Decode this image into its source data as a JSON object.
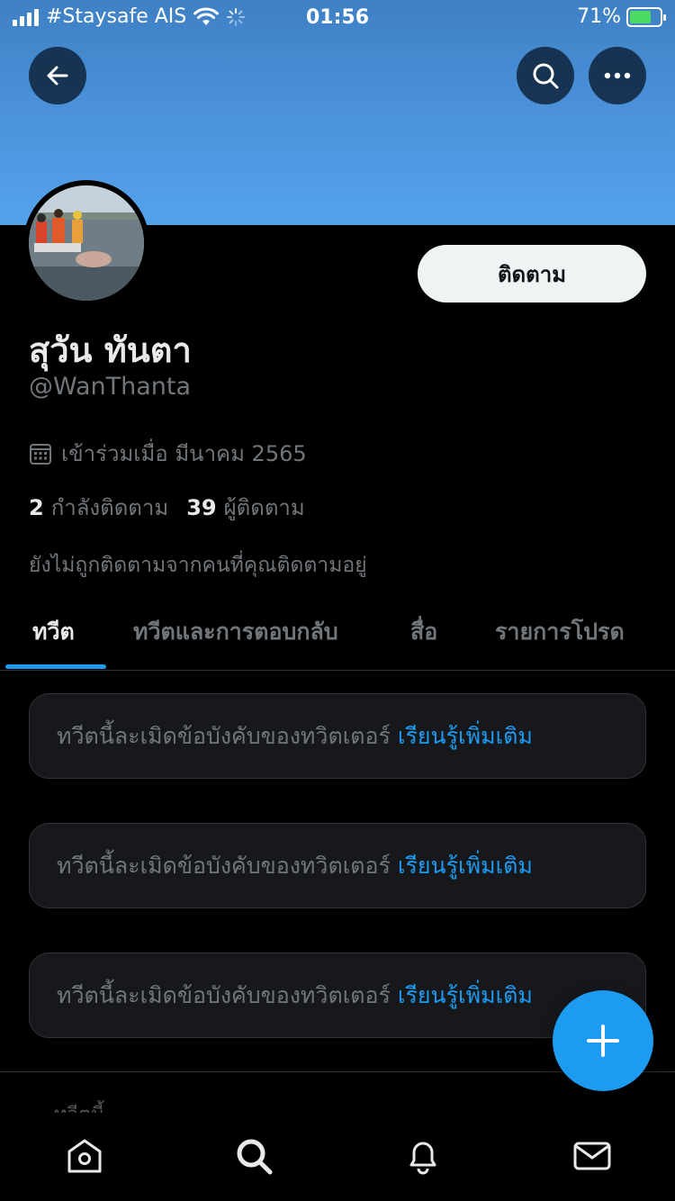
{
  "status_bar": {
    "carrier": "#Staysafe AIS",
    "time": "01:56",
    "battery": "71%",
    "battery_level": 0.71
  },
  "header": {
    "back_icon": "arrow-left-icon",
    "search_icon": "search-icon",
    "more_icon": "more-horizontal-icon"
  },
  "profile": {
    "display_name": "สุวัน ทันตา",
    "handle": "@WanThanta",
    "joined": "เข้าร่วมเมื่อ มีนาคม 2565",
    "following_count": "2",
    "following_label": "กำลังติดตาม",
    "followers_count": "39",
    "followers_label": "ผู้ติดตาม",
    "not_followed_note": "ยังไม่ถูกติดตามจากคนที่คุณติดตามอยู่",
    "follow_button": "ติดตาม"
  },
  "tabs": [
    {
      "label": "ทวีต",
      "active": true
    },
    {
      "label": "ทวีตและการตอบกลับ",
      "active": false
    },
    {
      "label": "สื่อ",
      "active": false
    },
    {
      "label": "รายการโปรด",
      "active": false
    }
  ],
  "notices": [
    {
      "text": "ทวีตนี้ละเมิดข้อบังคับของทวิตเตอร์",
      "link": "เรียนรู้เพิ่มเติม"
    },
    {
      "text": "ทวีตนี้ละเมิดข้อบังคับของทวิตเตอร์",
      "link": "เรียนรู้เพิ่มเติม"
    },
    {
      "text": "ทวีตนี้ละเมิดข้อบังคับของทวิตเตอร์",
      "link": "เรียนรู้เพิ่มเติม"
    }
  ],
  "peek_text": "ทวีตนี้",
  "colors": {
    "accent": "#1d9bf0",
    "banner": "#4c94dc",
    "background": "#000000",
    "muted_text": "#71767b"
  },
  "bottom_nav": [
    "home-icon",
    "search-icon",
    "notifications-icon",
    "messages-icon"
  ]
}
